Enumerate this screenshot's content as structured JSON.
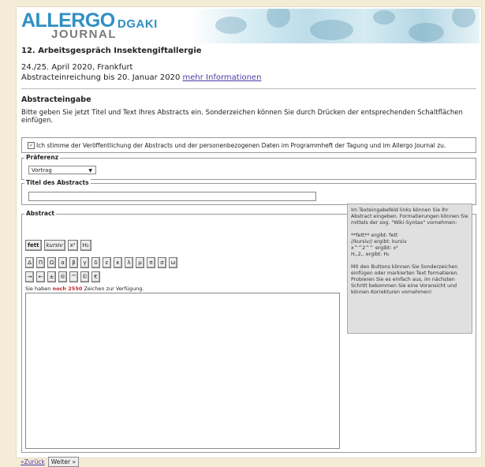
{
  "logo": {
    "allergo": "ALLERGO",
    "dgaki": "DGAKI",
    "journal": "JOURNAL"
  },
  "event": {
    "title": "12. Arbeitsgespräch Insektengiftallergie",
    "date": "24./25. April 2020, Frankfurt",
    "deadline": "Abstracteinreichung bis 20. Januar 2020",
    "more_link": "mehr Informationen"
  },
  "form": {
    "section_title": "Abstracteingabe",
    "intro": "Bitte geben Sie jetzt Titel und Text Ihres Abstracts ein. Sonderzeichen können Sie durch Drücken der entsprechenden Schaltflächen einfügen.",
    "consent": "Ich stimme der Veröffentlichung der Abstracts und der personenbezogenen Daten im Programmheft der Tagung und im Allergo Journal zu.",
    "preference_legend": "Präferenz",
    "preference_value": "Vortrag",
    "title_legend": "Titel des Abstracts",
    "title_value": "",
    "abstract_legend": "Abstract"
  },
  "toolbar": {
    "format": [
      "fett",
      "kursiv",
      "x²",
      "H₂"
    ],
    "greek": [
      "Δ",
      "Π",
      "Ω",
      "α",
      "β",
      "γ",
      "δ",
      "ε",
      "κ",
      "λ",
      "μ",
      "π",
      "σ",
      "ω"
    ],
    "symbols": [
      "→",
      "←",
      "±",
      "®",
      "™",
      "©",
      "€"
    ]
  },
  "counter": {
    "prefix": "Sie haben",
    "highlight": "noch 2550",
    "suffix": "Zeichen zur Verfügung."
  },
  "help": {
    "p1": "Im Texteingabefeld links können Sie Ihr Abstract eingeben. Formatierungen können Sie mittels der sog. \"Wiki-Syntax\" vornehmen:",
    "l1": "**fett** ergibt: fett",
    "l2": "//kursiv// ergibt: kursiv",
    "l3": "x^^2^^ ergibt: x²",
    "l4": "H,,2,, ergibt: H₂",
    "p2": "Mit den Buttons können Sie Sonderzeichen einfügen oder markierten Text formatieren. Probieren Sie es einfach aus, im nächsten Schritt bekommen Sie eine Voransicht und können Korrekturen vornehmen!"
  },
  "nav": {
    "back": "«Zurück",
    "next": "Weiter »"
  }
}
